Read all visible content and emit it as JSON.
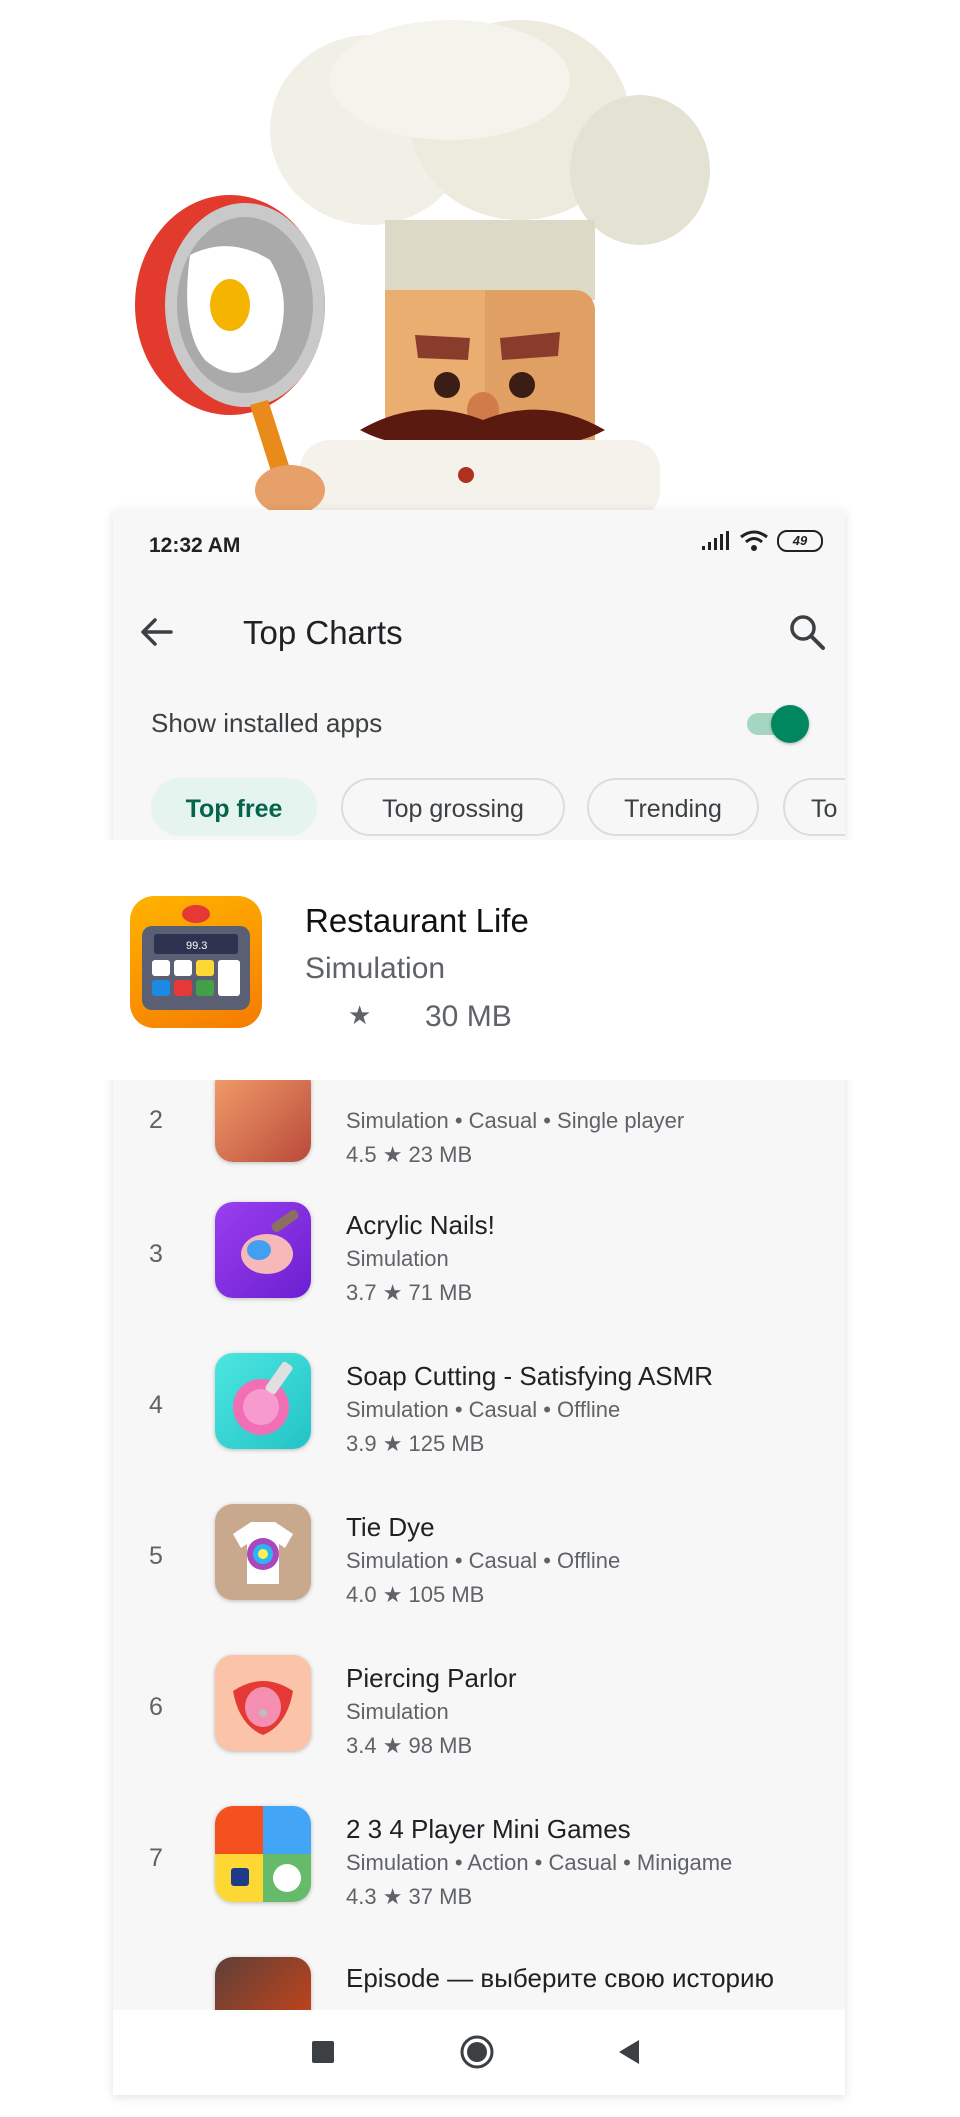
{
  "status_bar": {
    "time": "12:32 AM",
    "battery": "49"
  },
  "app_bar": {
    "title": "Top Charts"
  },
  "filter": {
    "show_installed_label": "Show installed apps",
    "show_installed_on": true
  },
  "chips": [
    "Top free",
    "Top grossing",
    "Trending",
    "To"
  ],
  "featured_app": {
    "name": "Restaurant Life",
    "category": "Simulation",
    "star": "★",
    "size": "30 MB",
    "icon_display": "99.3"
  },
  "apps": [
    {
      "rank": "2",
      "name": "",
      "categories": "Simulation  •  Casual  •  Single player",
      "meta": "4.5 ★   23 MB"
    },
    {
      "rank": "3",
      "name": "Acrylic Nails!",
      "categories": "Simulation",
      "meta": "3.7 ★   71 MB"
    },
    {
      "rank": "4",
      "name": "Soap Cutting - Satisfying ASMR",
      "categories": "Simulation  •  Casual  •  Offline",
      "meta": "3.9 ★   125 MB"
    },
    {
      "rank": "5",
      "name": "Tie Dye",
      "categories": "Simulation  •  Casual  •  Offline",
      "meta": "4.0 ★   105 MB"
    },
    {
      "rank": "6",
      "name": "Piercing Parlor",
      "categories": "Simulation",
      "meta": "3.4 ★   98 MB"
    },
    {
      "rank": "7",
      "name": "2 3 4 Player Mini Games",
      "categories": "Simulation  •  Action  •  Casual  •  Minigame",
      "meta": "4.3 ★   37 MB"
    },
    {
      "rank": "",
      "name": "Episode — выберите свою историю",
      "categories": "",
      "meta": ""
    }
  ],
  "colors": {
    "accent": "#01875f",
    "chip_active_bg": "#e6f4ef"
  }
}
